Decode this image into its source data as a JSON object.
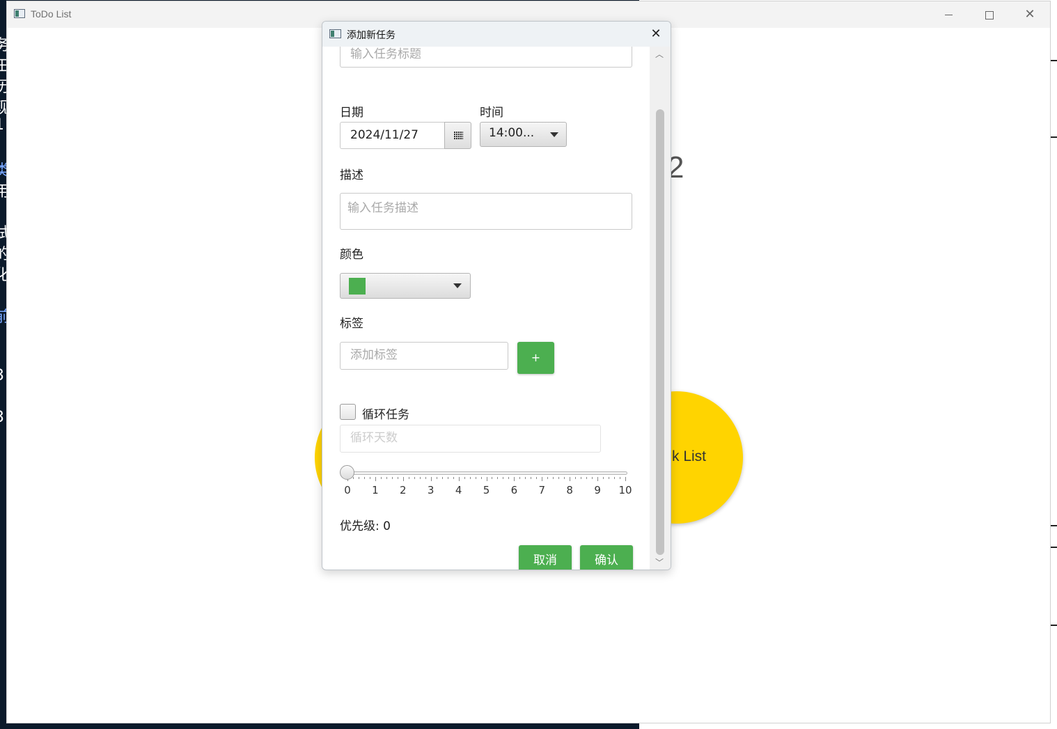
{
  "window": {
    "title": "ToDo List",
    "controls": {
      "minimize": "minimize",
      "maximize": "maximize",
      "close": "✕"
    }
  },
  "background": {
    "number_partial": "2",
    "circle_label_partial": "k List",
    "accent_color": "#FFD400"
  },
  "dialog": {
    "title": "添加新任务",
    "close_label": "✕",
    "title_placeholder": "输入任务标题",
    "date_label": "日期",
    "date_value": "2024/11/27",
    "time_label": "时间",
    "time_value": "14:00...",
    "description_label": "描述",
    "description_placeholder": "输入任务描述",
    "color_label": "颜色",
    "color_value": "#4CAF50",
    "tags_label": "标签",
    "tag_placeholder": "添加标签",
    "add_tag_button": "+",
    "recurring_label": "循环任务",
    "recurring_checked": false,
    "recurring_days_placeholder": "循环天数",
    "slider": {
      "min": 0,
      "max": 10,
      "value": 0,
      "tick_labels": [
        "0",
        "1",
        "2",
        "3",
        "4",
        "5",
        "6",
        "7",
        "8",
        "9",
        "10"
      ]
    },
    "priority_text": "优先级: 0",
    "cancel_button": "取消",
    "confirm_button": "确认",
    "button_color": "#4CAF50"
  }
}
